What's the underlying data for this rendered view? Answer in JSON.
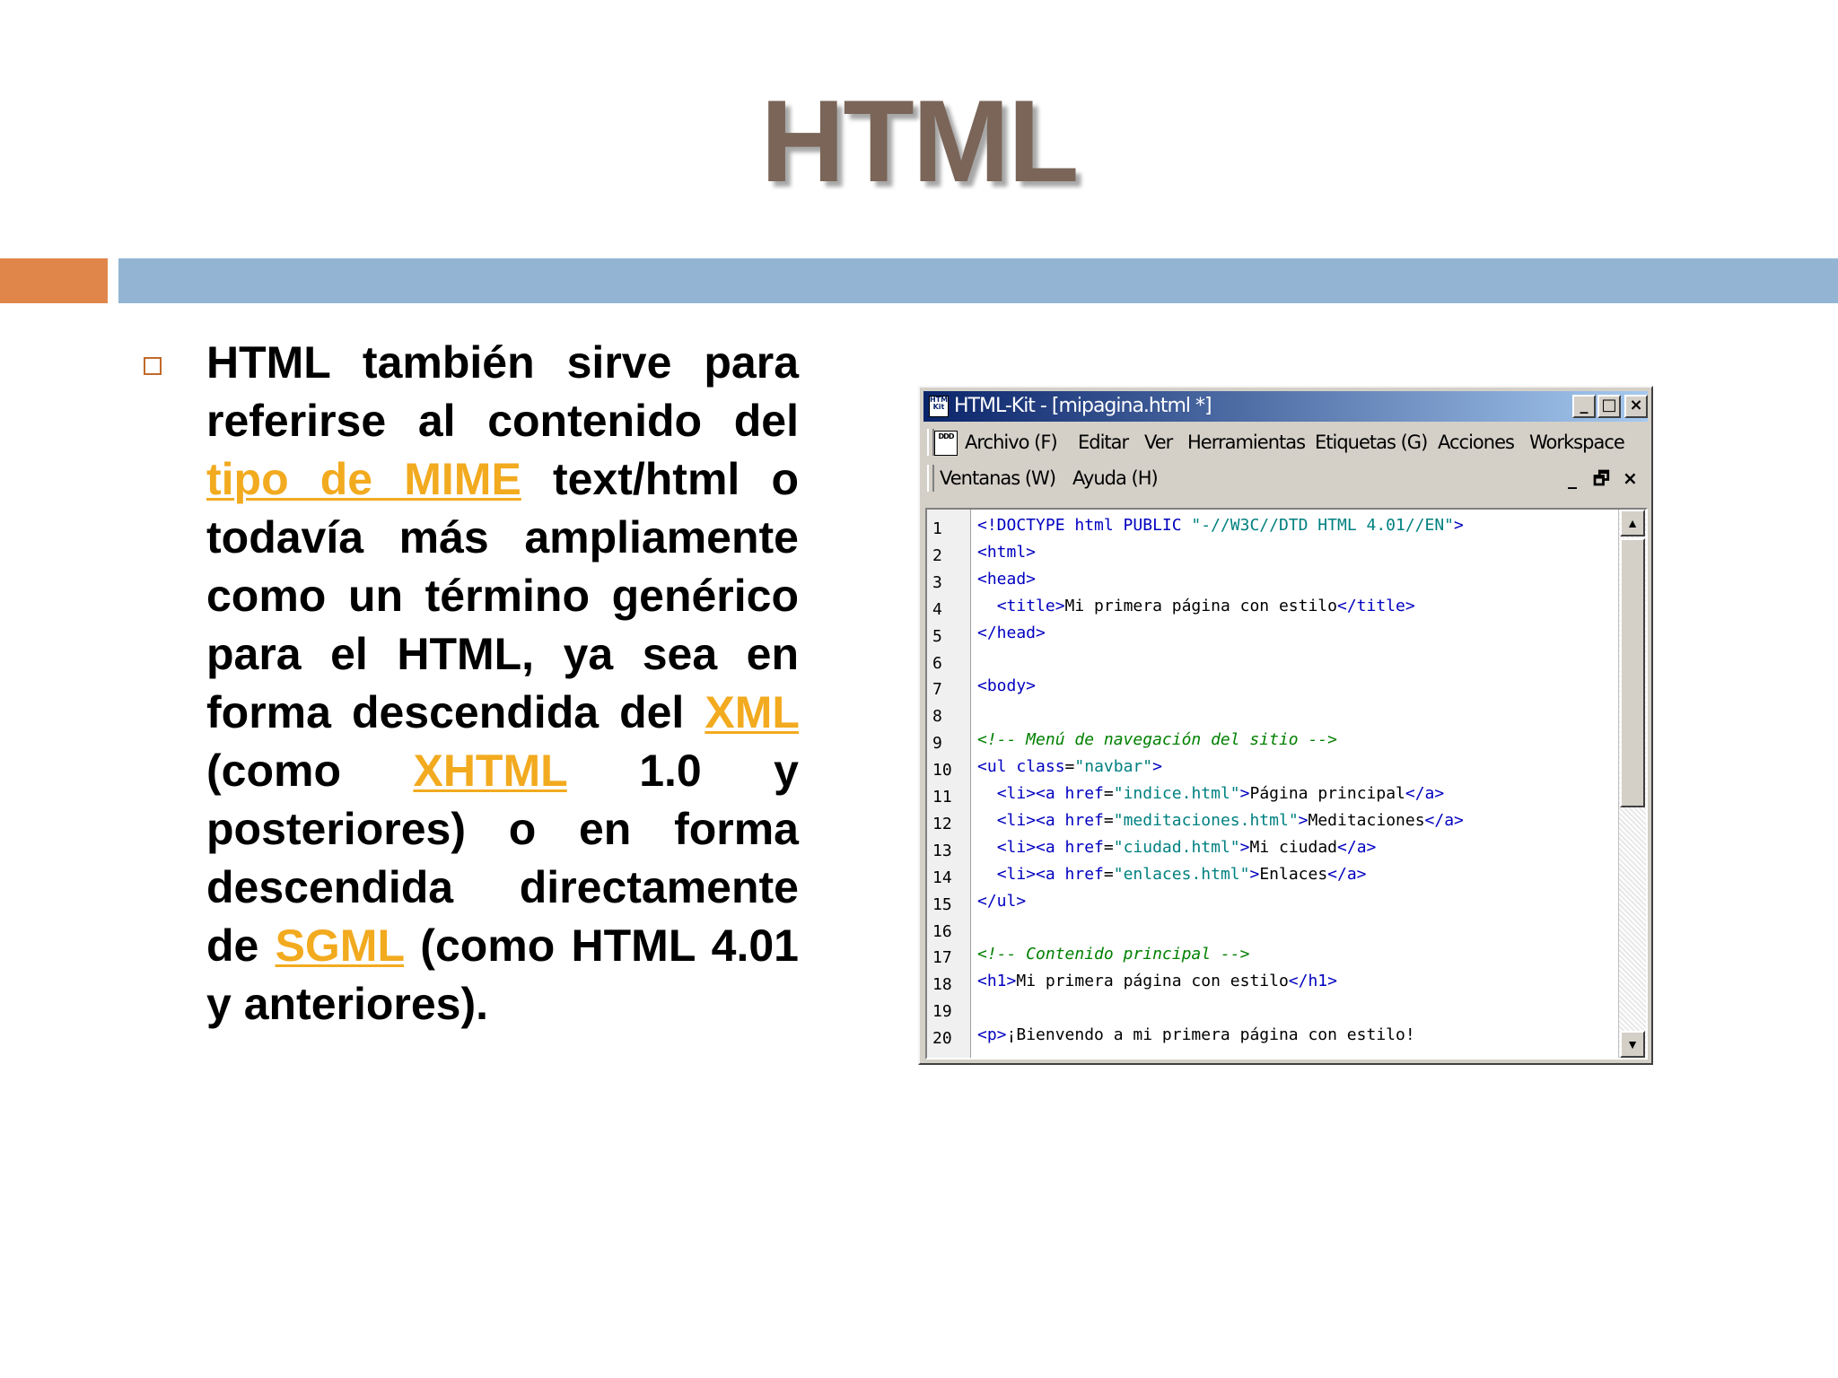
{
  "slide": {
    "title": "HTML",
    "paragraph": {
      "t1": "HTML también sirve para referirse al contenido del ",
      "link1": "tipo de MIME",
      "t2": " text/html o todavía más ampliamente como un término genérico para el HTML, ya sea en forma descendida del ",
      "link2": "XML",
      "t3": " (como ",
      "link3": "XHTML",
      "t4": " 1.0 y posteriores) o en forma descendida directamente de ",
      "link4": "SGML",
      "t5": " (como HTML 4.01 y anteriores)."
    },
    "colors": {
      "title": "#7a6558",
      "orange_bar": "#e0864a",
      "blue_bar": "#93b5d3",
      "link": "#f2aa1f"
    }
  },
  "window": {
    "title": "HTML-Kit - [mipagina.html *]",
    "app_icon_text": "HTML Kit",
    "minimize": "_",
    "maximize": "□",
    "close": "×",
    "doc_icon_text": "DDD",
    "menu1": [
      "Archivo (F)",
      "Editar",
      "Ver",
      "Herramientas",
      "Etiquetas (G)",
      "Acciones",
      "Workspace"
    ],
    "menu2": [
      "Ventanas (W)",
      "Ayuda (H)"
    ],
    "mdi_minimize": "_",
    "mdi_restore": "🗗",
    "mdi_close": "×",
    "scroll_up": "▲",
    "scroll_down": "▼",
    "line_numbers": [
      "1",
      "2",
      "3",
      "4",
      "5",
      "6",
      "7",
      "8",
      "9",
      "10",
      "11",
      "12",
      "13",
      "14",
      "15",
      "16",
      "17",
      "18",
      "19",
      "20"
    ],
    "code": [
      [
        [
          "tag",
          "<!DOCTYPE html PUBLIC "
        ],
        [
          "val",
          "\"-//W3C//DTD HTML 4.01//EN\""
        ],
        [
          "tag",
          ">"
        ]
      ],
      [
        [
          "tag",
          "<html>"
        ]
      ],
      [
        [
          "tag",
          "<head>"
        ]
      ],
      [
        [
          "txt",
          "  "
        ],
        [
          "tag",
          "<title>"
        ],
        [
          "txt",
          "Mi primera página con estilo"
        ],
        [
          "tag",
          "</title>"
        ]
      ],
      [
        [
          "tag",
          "</head>"
        ]
      ],
      [],
      [
        [
          "tag",
          "<body>"
        ]
      ],
      [],
      [
        [
          "cmt",
          "<!-- Menú de navegación del sitio -->"
        ]
      ],
      [
        [
          "tag",
          "<ul "
        ],
        [
          "attr",
          "class"
        ],
        [
          "txt",
          "="
        ],
        [
          "val",
          "\"navbar\""
        ],
        [
          "tag",
          ">"
        ]
      ],
      [
        [
          "txt",
          "  "
        ],
        [
          "tag",
          "<li><a "
        ],
        [
          "attr",
          "href"
        ],
        [
          "txt",
          "="
        ],
        [
          "val",
          "\"indice.html\""
        ],
        [
          "tag",
          ">"
        ],
        [
          "txt",
          "Página principal"
        ],
        [
          "tag",
          "</a>"
        ]
      ],
      [
        [
          "txt",
          "  "
        ],
        [
          "tag",
          "<li><a "
        ],
        [
          "attr",
          "href"
        ],
        [
          "txt",
          "="
        ],
        [
          "val",
          "\"meditaciones.html\""
        ],
        [
          "tag",
          ">"
        ],
        [
          "txt",
          "Meditaciones"
        ],
        [
          "tag",
          "</a>"
        ]
      ],
      [
        [
          "txt",
          "  "
        ],
        [
          "tag",
          "<li><a "
        ],
        [
          "attr",
          "href"
        ],
        [
          "txt",
          "="
        ],
        [
          "val",
          "\"ciudad.html\""
        ],
        [
          "tag",
          ">"
        ],
        [
          "txt",
          "Mi ciudad"
        ],
        [
          "tag",
          "</a>"
        ]
      ],
      [
        [
          "txt",
          "  "
        ],
        [
          "tag",
          "<li><a "
        ],
        [
          "attr",
          "href"
        ],
        [
          "txt",
          "="
        ],
        [
          "val",
          "\"enlaces.html\""
        ],
        [
          "tag",
          ">"
        ],
        [
          "txt",
          "Enlaces"
        ],
        [
          "tag",
          "</a>"
        ]
      ],
      [
        [
          "tag",
          "</ul>"
        ]
      ],
      [],
      [
        [
          "cmt",
          "<!-- Contenido principal -->"
        ]
      ],
      [
        [
          "tag",
          "<h1>"
        ],
        [
          "txt",
          "Mi primera página con estilo"
        ],
        [
          "tag",
          "</h1>"
        ]
      ],
      [],
      [
        [
          "tag",
          "<p>"
        ],
        [
          "txt",
          "¡Bienvendo a mi primera página con estilo!"
        ]
      ]
    ]
  }
}
